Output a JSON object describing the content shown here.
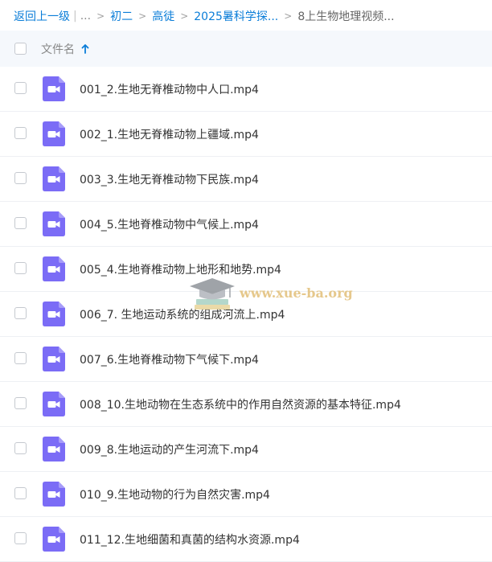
{
  "breadcrumb": {
    "back": "返回上一级",
    "separator": "|",
    "ellipsis": "...",
    "arrow": ">",
    "items": [
      "初二",
      "高徒",
      "2025暑科学探..."
    ],
    "current": "8上生物地理视频..."
  },
  "header": {
    "column_label": "文件名",
    "sort_icon": "arrow-up-icon"
  },
  "file_icon": "video-file-icon",
  "files": [
    "001_2.生地无脊椎动物中人口.mp4",
    "002_1.生地无脊椎动物上疆域.mp4",
    "003_3.生地无脊椎动物下民族.mp4",
    "004_5.生地脊椎动物中气候上.mp4",
    "005_4.生地脊椎动物上地形和地势.mp4",
    "006_7. 生地运动系统的组成河流上.mp4",
    "007_6.生地脊椎动物下气候下.mp4",
    "008_10.生地动物在生态系统中的作用自然资源的基本特征.mp4",
    "009_8.生地运动的产生河流下.mp4",
    "010_9.生地动物的行为自然灾害.mp4",
    "011_12.生地细菌和真菌的结构水资源.mp4"
  ],
  "watermark": {
    "text": "www.xue-ba.org"
  },
  "colors": {
    "link": "#0a7dd8",
    "icon": "#7b6cf6",
    "header_bg": "#f5f8fc"
  }
}
